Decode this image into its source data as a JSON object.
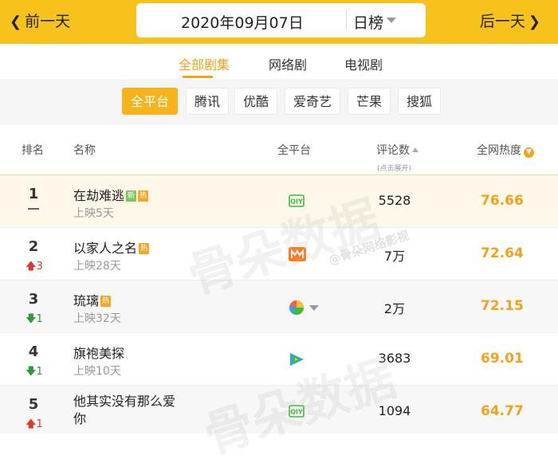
{
  "topbar": {
    "prev_label": "前一天",
    "date": "2020年09月07日",
    "period": "日榜",
    "next_label": "后一天"
  },
  "categories": [
    "全部剧集",
    "网络剧",
    "电视剧"
  ],
  "platforms": [
    "全平台",
    "腾讯",
    "优酷",
    "爱奇艺",
    "芒果",
    "搜狐"
  ],
  "table": {
    "headers": {
      "rank": "排名",
      "name": "名称",
      "platform": "全平台",
      "comments": "评论数",
      "comments_sub": "(点击展开)",
      "heat": "全网热度"
    },
    "rows": [
      {
        "rank": "1",
        "change": "",
        "title": "在劫难逃",
        "badges": [
          "新",
          "热"
        ],
        "days": "上映5天",
        "platform_icon": "iqiyi-icon",
        "comments": "5528",
        "heat": "76.66"
      },
      {
        "rank": "2",
        "change": "3",
        "change_dir": "up",
        "title": "以家人之名",
        "badges": [
          "热"
        ],
        "days": "上映28天",
        "platform_icon": "mango-icon",
        "comments": "7万",
        "heat": "72.64"
      },
      {
        "rank": "3",
        "change": "1",
        "change_dir": "down",
        "title": "琉璃",
        "badges": [
          "热"
        ],
        "days": "上映32天",
        "platform_icon": "multi-platform-icon",
        "comments": "2万",
        "heat": "72.15"
      },
      {
        "rank": "4",
        "change": "1",
        "change_dir": "down",
        "title": "旗袍美探",
        "badges": [],
        "days": "上映10天",
        "platform_icon": "tencent-video-icon",
        "comments": "3683",
        "heat": "69.01"
      },
      {
        "rank": "5",
        "change": "1",
        "change_dir": "up",
        "title": "他其实没有那么爱你",
        "badges": [],
        "days": "",
        "platform_icon": "iqiyi-icon",
        "comments": "1094",
        "heat": "64.77"
      }
    ]
  },
  "watermark": {
    "main": "骨朵数据",
    "sub": "@骨朵网络影视"
  },
  "colors": {
    "accent": "#f7c21b",
    "heat": "#f4a21a",
    "up": "#e2362f",
    "down": "#2f9a3b"
  }
}
